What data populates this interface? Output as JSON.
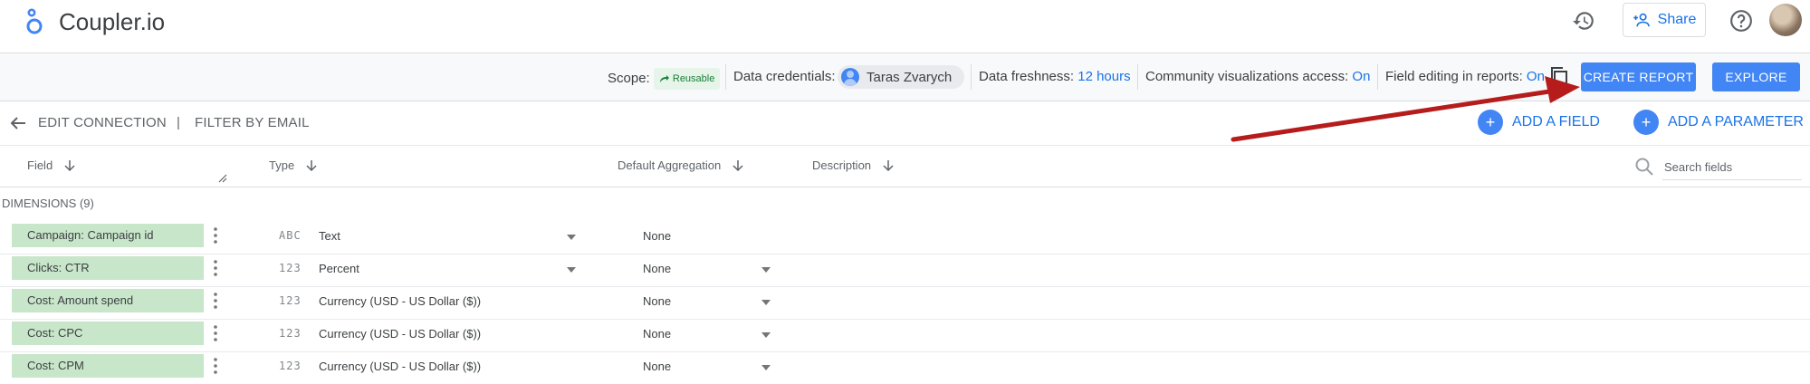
{
  "app": {
    "title": "Coupler.io"
  },
  "topbar": {
    "share_label": "Share"
  },
  "connection": {
    "scope_label": "Scope:",
    "scope_chip": "Reusable",
    "credentials_label": "Data credentials:",
    "credentials_user": "Taras Zvarych",
    "freshness_label": "Data freshness:",
    "freshness_value": "12 hours",
    "community_label": "Community visualizations access:",
    "community_value": "On",
    "field_editing_label": "Field editing in reports:",
    "field_editing_value": "On",
    "create_report_label": "CREATE REPORT",
    "explore_label": "EXPLORE"
  },
  "actions": {
    "edit_connection": "EDIT CONNECTION",
    "divider": "|",
    "filter_by_email": "FILTER BY EMAIL",
    "add_field": "ADD A FIELD",
    "add_parameter": "ADD A PARAMETER"
  },
  "columns": {
    "field": "Field",
    "type": "Type",
    "aggregation": "Default Aggregation",
    "description": "Description",
    "search_placeholder": "Search fields"
  },
  "dimensions_label": "DIMENSIONS (9)",
  "rows": [
    {
      "field": "Campaign: Campaign id",
      "type_icon": "ABC",
      "type": "Text",
      "aggregation": "None"
    },
    {
      "field": "Clicks: CTR",
      "type_icon": "123",
      "type": "Percent",
      "aggregation": "None"
    },
    {
      "field": "Cost: Amount spend",
      "type_icon": "123",
      "type": "Currency (USD - US Dollar ($))",
      "aggregation": "None"
    },
    {
      "field": "Cost: CPC",
      "type_icon": "123",
      "type": "Currency (USD - US Dollar ($))",
      "aggregation": "None"
    },
    {
      "field": "Cost: CPM",
      "type_icon": "123",
      "type": "Currency (USD - US Dollar ($))",
      "aggregation": "None"
    }
  ],
  "colors": {
    "accent": "#4285f4",
    "link": "#1a73e8",
    "chip_green": "#c8e6c9",
    "annotation_arrow": "#b71c1c"
  }
}
